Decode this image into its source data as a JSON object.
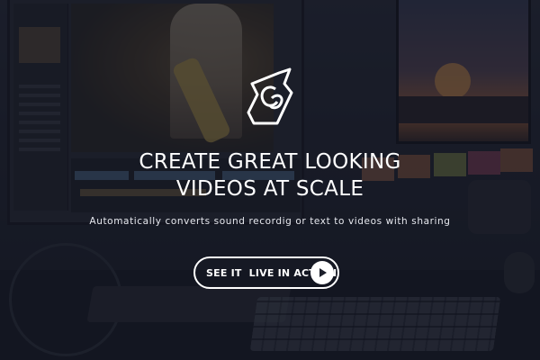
{
  "hero": {
    "logo_icon": "stylized-cb-monogram-icon",
    "headline_line1": "CREATE GREAT LOOKING",
    "headline_line2": "VIDEOS AT SCALE",
    "subtitle": "Automatically converts sound recordig or text to videos with sharing",
    "cta_label": "SEE IT  LIVE IN ACTION",
    "cta_icon": "play-icon",
    "overlay_color": "#121522",
    "text_color": "#ffffff"
  },
  "background": {
    "sticky_note_colors": [
      "#e58a5a",
      "#c7d15a",
      "#d85a78",
      "#e8874a",
      "#a7c24a"
    ]
  }
}
